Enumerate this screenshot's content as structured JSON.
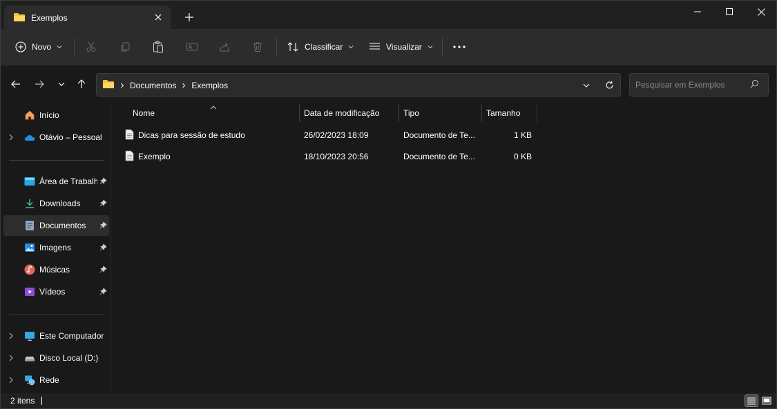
{
  "tab": {
    "title": "Exemplos",
    "close_icon": "close-icon",
    "new_tab_icon": "plus-icon"
  },
  "window_controls": {
    "minimize": "minimize-icon",
    "maximize": "maximize-icon",
    "close": "close-icon"
  },
  "toolbar": {
    "new_label": "Novo",
    "sort_label": "Classificar",
    "view_label": "Visualizar",
    "icons": [
      "cut-icon",
      "copy-icon",
      "paste-icon",
      "rename-icon",
      "share-icon",
      "delete-icon",
      "more-icon"
    ]
  },
  "address": {
    "crumbs": [
      "Documentos",
      "Exemplos"
    ],
    "search_placeholder": "Pesquisar em Exemplos"
  },
  "sidebar": {
    "top": [
      {
        "label": "Início",
        "icon": "home-icon",
        "expandable": false
      },
      {
        "label": "Otávio – Pessoal",
        "icon": "onedrive-icon",
        "expandable": true
      }
    ],
    "quick_access": [
      {
        "label": "Área de Trabalho",
        "icon": "desktop-icon",
        "pinned": true
      },
      {
        "label": "Downloads",
        "icon": "download-icon",
        "pinned": true
      },
      {
        "label": "Documentos",
        "icon": "documents-icon",
        "pinned": true,
        "selected": true
      },
      {
        "label": "Imagens",
        "icon": "pictures-icon",
        "pinned": true
      },
      {
        "label": "Músicas",
        "icon": "music-icon",
        "pinned": true
      },
      {
        "label": "Vídeos",
        "icon": "videos-icon",
        "pinned": true
      }
    ],
    "devices": [
      {
        "label": "Este Computador",
        "icon": "computer-icon"
      },
      {
        "label": "Disco Local (D:)",
        "icon": "drive-icon"
      },
      {
        "label": "Rede",
        "icon": "network-icon"
      }
    ]
  },
  "columns": [
    "Nome",
    "Data de modificação",
    "Tipo",
    "Tamanho"
  ],
  "files": [
    {
      "name": "Dicas para sessão de estudo",
      "modified": "26/02/2023 18:09",
      "type": "Documento de Te...",
      "size": "1 KB"
    },
    {
      "name": "Exemplo",
      "modified": "18/10/2023 20:56",
      "type": "Documento de Te...",
      "size": "0 KB"
    }
  ],
  "status": {
    "count": "2 itens"
  },
  "colors": {
    "accent_folder": "#f3c33e",
    "background": "#191919",
    "toolbar": "#2c2c2c"
  }
}
